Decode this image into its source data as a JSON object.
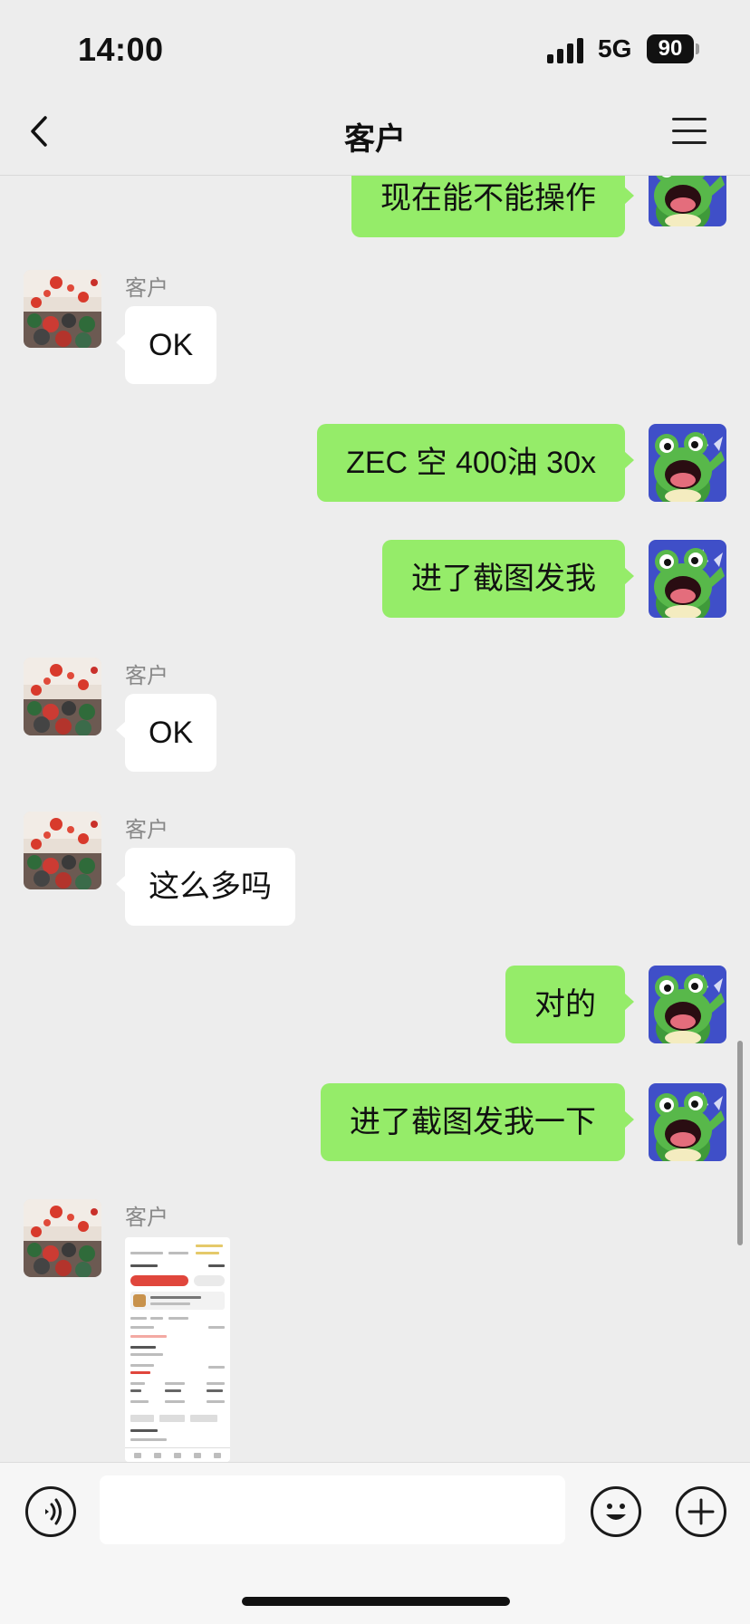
{
  "status_bar": {
    "time": "14:00",
    "network": "5G",
    "battery": "90"
  },
  "header": {
    "title": "客户"
  },
  "messages": [
    {
      "dir": "out",
      "text": "现在能不能操作"
    },
    {
      "dir": "in",
      "sender": "客户",
      "text": "OK"
    },
    {
      "dir": "out",
      "text": "ZEC 空 400油 30x"
    },
    {
      "dir": "out",
      "text": "进了截图发我"
    },
    {
      "dir": "in",
      "sender": "客户",
      "text": "OK"
    },
    {
      "dir": "in",
      "sender": "客户",
      "text": "这么多吗"
    },
    {
      "dir": "out",
      "text": "对的"
    },
    {
      "dir": "out",
      "text": "进了截图发我一下"
    },
    {
      "dir": "in",
      "sender": "客户",
      "type": "image"
    }
  ],
  "input_bar": {
    "voice_icon": "voice-icon",
    "emoji_icon": "emoji-icon",
    "plus_icon": "plus-icon"
  },
  "colors": {
    "outgoing_bubble": "#95ec69",
    "incoming_bubble": "#ffffff",
    "background": "#ededed"
  }
}
